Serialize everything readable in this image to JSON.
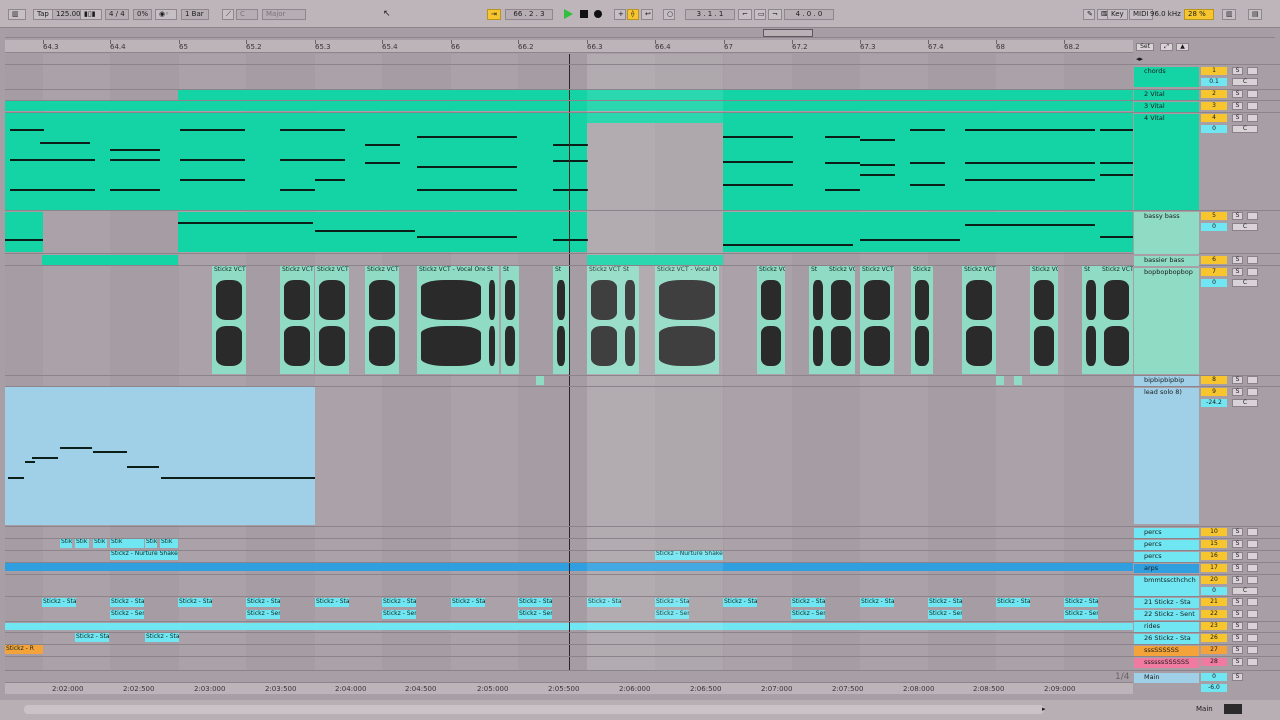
{
  "transport": {
    "tap": "Tap",
    "tempo": "125.00",
    "sig": "4 / 4",
    "groove": "0%",
    "quantize": "1 Bar",
    "key": "C",
    "scale": "Major",
    "position": "66 .  2 .  3",
    "loop_start": "3 .  1 .  1",
    "loop_len": "4 .  0 .  0",
    "key_btn": "Key",
    "midi_btn": "MIDI",
    "sample_rate": "96.0 kHz",
    "cpu": "28 %"
  },
  "ruler": {
    "bars": [
      "64.3",
      "64.4",
      "65",
      "65.2",
      "65.3",
      "65.4",
      "66",
      "66.2",
      "66.3",
      "66.4",
      "67",
      "67.2",
      "67.3",
      "67.4",
      "68",
      "68.2"
    ],
    "set_label": "Set"
  },
  "time_labels": [
    "2:02:000",
    "2:02:500",
    "2:03:000",
    "2:03:500",
    "2:04:000",
    "2:04:500",
    "2:05:000",
    "2:05:500",
    "2:06:000",
    "2:06:500",
    "2:07:000",
    "2:07:500",
    "2:08:000",
    "2:08:500",
    "2:09:000"
  ],
  "tracks": [
    {
      "name": "chords",
      "num": "1",
      "vol": "0.1",
      "pan": "C"
    },
    {
      "name": "2 Vital",
      "num": "2"
    },
    {
      "name": "3 Vital",
      "num": "3"
    },
    {
      "name": "4 Vital",
      "num": "4",
      "vol": "0",
      "pan": "C"
    },
    {
      "name": "bassy bass",
      "num": "5",
      "vol": "0",
      "pan": "C"
    },
    {
      "name": "bassier bass",
      "num": "6"
    },
    {
      "name": "bopbopbopbop",
      "num": "7",
      "vol": "0",
      "pan": "C"
    },
    {
      "name": "bipbipbipbip",
      "num": "8"
    },
    {
      "name": "lead solo 8)",
      "num": "9",
      "vol": "-24.2",
      "pan": "C"
    },
    {
      "name": "percs",
      "num": "10"
    },
    {
      "name": "percs",
      "num": "15"
    },
    {
      "name": "percs",
      "num": "16"
    },
    {
      "name": "arps",
      "num": "17"
    },
    {
      "name": "bmmtsscthchch",
      "num": "20",
      "vol": "0",
      "pan": "C"
    },
    {
      "name": "21 Stickz - Sta",
      "num": "21"
    },
    {
      "name": "22 Stickz - Sent",
      "num": "22"
    },
    {
      "name": "rides",
      "num": "23"
    },
    {
      "name": "26 Stickz - Sta",
      "num": "26"
    },
    {
      "name": "sssSSSSSS",
      "num": "27"
    },
    {
      "name": "ssssssSSSSSS",
      "num": "28"
    },
    {
      "name": "Main",
      "num": "0",
      "vol": "-6.0"
    }
  ],
  "clips": {
    "vocal": "Stickz VCT",
    "vocal_long": "Stickz VCT - Vocal One",
    "vocal_o": "Stickz VCT - Vocal O",
    "stick": "Stickz - Sta",
    "sent": "Stickz - Sent",
    "nurture": "Stickz - Nurture Shake",
    "perc_small": "Stik",
    "stickz_r": "Stickz - R",
    "st": "St"
  },
  "footer": {
    "zoom": "1/4",
    "main_label": "Main",
    "pct": "100%"
  },
  "colors": {
    "teal": "#14d3a5",
    "cyan": "#6fe6f2",
    "yellow": "#f7c62e",
    "orange": "#f3a33a",
    "pink": "#f07aa0",
    "bg": "#a59da3"
  }
}
